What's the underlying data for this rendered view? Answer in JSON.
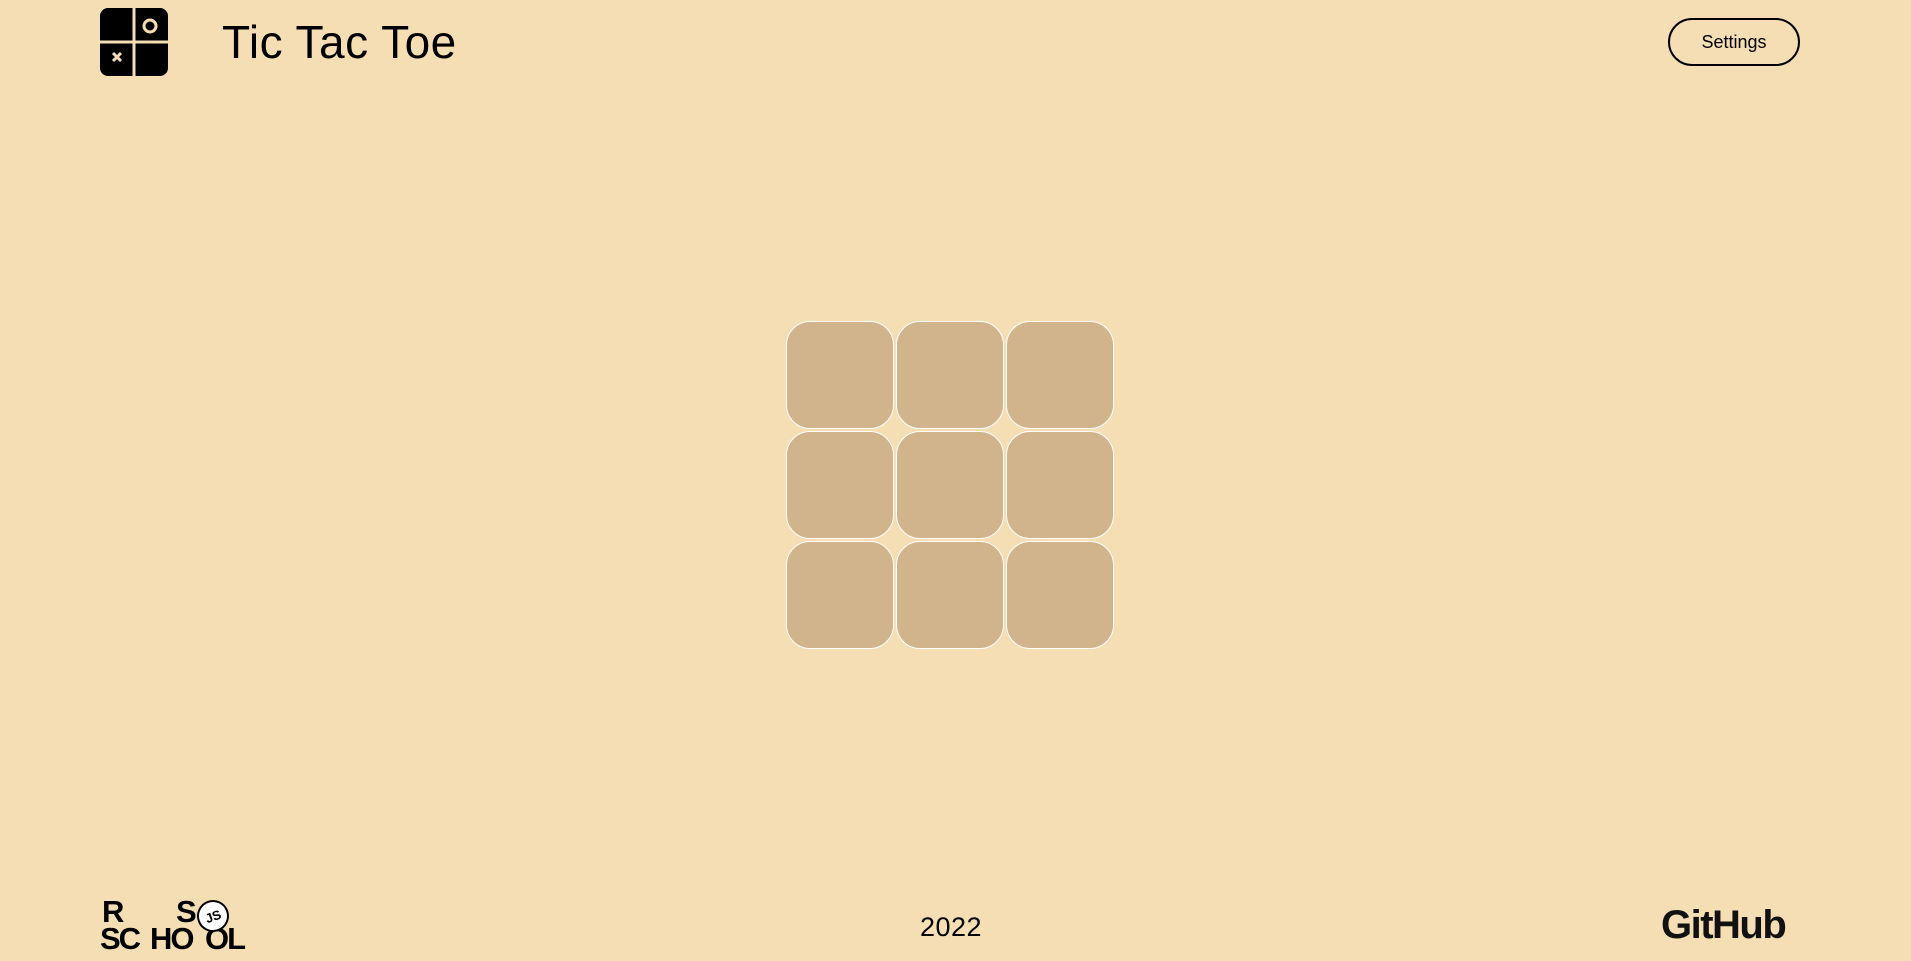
{
  "app": {
    "title": "Tic Tac Toe"
  },
  "header": {
    "logo_icon": "tic-tac-toe-logo-icon",
    "settings_label": "Settings"
  },
  "board": {
    "rows": 3,
    "cols": 3,
    "cells": [
      "",
      "",
      "",
      "",
      "",
      "",
      "",
      "",
      ""
    ]
  },
  "footer": {
    "school_logo_icon": "rs-school-js-logo-icon",
    "school_logo_letters": {
      "r": "R",
      "s": "S",
      "sc": "SC",
      "ho": "HO",
      "ol": "OL",
      "js": "JS"
    },
    "year": "2022",
    "github_label": "GitHub"
  },
  "colors": {
    "background": "#f5deb3",
    "cell": "#d2b48c",
    "cell_border": "#ffffff",
    "text": "#000000"
  }
}
